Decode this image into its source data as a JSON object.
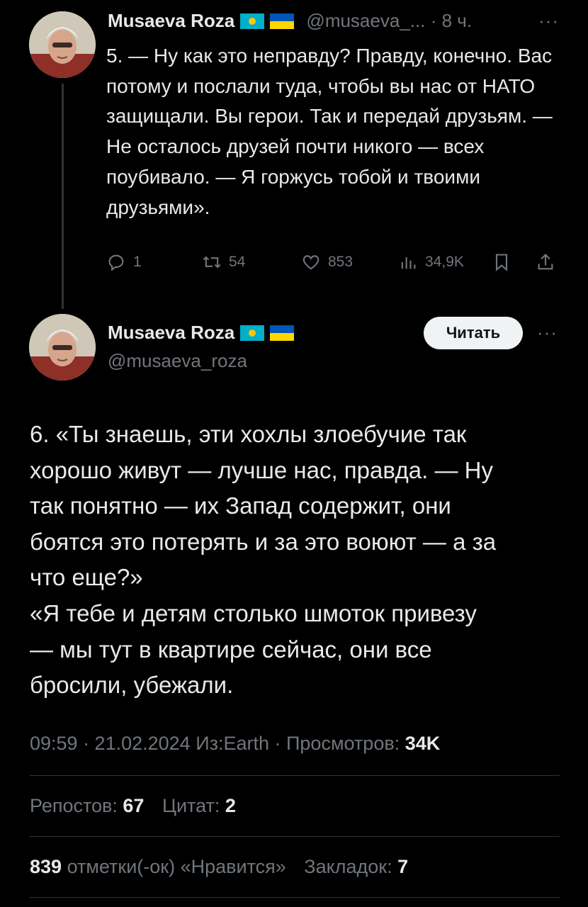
{
  "tweet1": {
    "author_name": "Musaeva Roza",
    "handle": "@musaeva_...",
    "separator": "·",
    "time": "8 ч.",
    "more": "···",
    "text": "5. — Ну как это неправду? Правду, конечно. Вас потому и послали туда, чтобы вы нас от НАТО защищали. Вы герои. Так и передай друзьям. — Не осталось друзей почти никого — всех поубивало. — Я горжусь тобой и твоими друзьями».",
    "replies": "1",
    "reposts": "54",
    "likes": "853",
    "views": "34,9K"
  },
  "tweet2": {
    "author_name": "Musaeva Roza",
    "handle": "@musaeva_roza",
    "read_button": "Читать",
    "more": "···",
    "text_lines": [
      "6. «Ты знаешь, эти хохлы злоебучие так",
      "хорошо живут — лучше нас, правда. — Ну",
      "так понятно — их Запад содержит, они",
      "боятся это потерять и за это воюют — а за",
      "что еще?»",
      "«Я тебе и детям столько шмоток привезу",
      "— мы тут в квартире сейчас, они все",
      "бросили, убежали."
    ],
    "timestamp": "09:59 · 21.02.2024 Из:Earth · Просмотров: ",
    "views_count": "34K",
    "reposts_label": "Репостов: ",
    "reposts_count": "67",
    "quotes_label": "Цитат: ",
    "quotes_count": "2",
    "likes_count": "839",
    "likes_label": " отметки(-ок) «Нравится»",
    "bookmarks_label": "Закладок: ",
    "bookmarks_count": "7"
  },
  "icons": {
    "reply": "reply-icon",
    "repost": "repost-icon",
    "like": "heart-icon",
    "views": "views-icon",
    "bookmark": "bookmark-icon",
    "share": "share-icon",
    "flag_kz": "kazakhstan-flag-icon",
    "flag_ua": "ukraine-flag-icon"
  },
  "colors": {
    "background": "#000000",
    "text": "#e7e9ea",
    "muted": "#71767b",
    "divider": "#2f3336",
    "button_bg": "#eff3f4"
  }
}
